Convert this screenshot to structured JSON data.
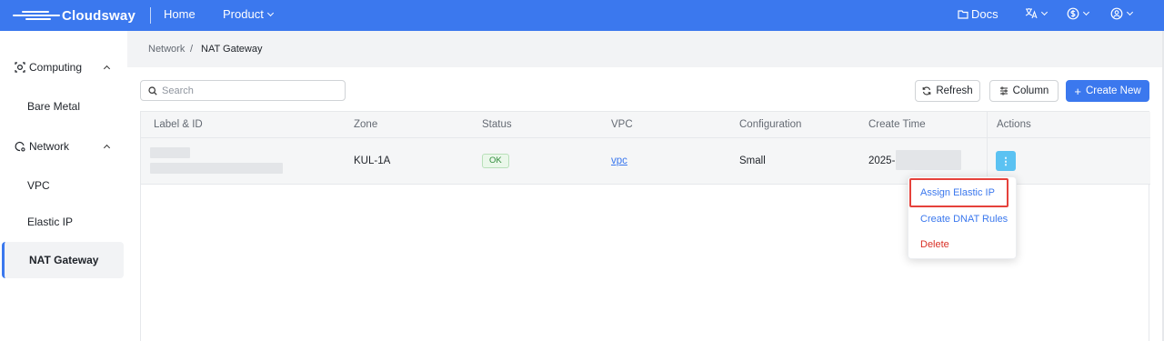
{
  "colors": {
    "brand": "#3b78ee",
    "danger": "#d93026",
    "status_ok": "#2e8b3a",
    "action_button": "#5bc2f2"
  },
  "header": {
    "logo_text": "Cloudsway",
    "nav": [
      {
        "label": "Home"
      },
      {
        "label": "Product"
      }
    ],
    "docs_label": "Docs",
    "icons": [
      "folder-icon",
      "translate-icon",
      "currency-icon",
      "user-circle-icon"
    ]
  },
  "sidebar": {
    "groups": [
      {
        "label": "Computing",
        "icon": "computing-icon",
        "expanded": true,
        "items": [
          {
            "label": "Bare Metal"
          }
        ]
      },
      {
        "label": "Network",
        "icon": "network-icon",
        "expanded": true,
        "items": [
          {
            "label": "VPC"
          },
          {
            "label": "Elastic IP"
          },
          {
            "label": "NAT Gateway",
            "active": true
          }
        ]
      }
    ]
  },
  "breadcrumb": {
    "items": [
      "Network",
      "NAT Gateway"
    ],
    "separator": "/"
  },
  "toolbar": {
    "search_placeholder": "Search",
    "refresh_label": "Refresh",
    "column_label": "Column",
    "create_label": "Create New"
  },
  "table": {
    "columns": [
      "Label & ID",
      "Zone",
      "Status",
      "VPC",
      "Configuration",
      "Create Time",
      "Actions"
    ],
    "rows": [
      {
        "zone": "KUL-1A",
        "status": "OK",
        "vpc": "vpc",
        "configuration": "Small",
        "create_time": "2025-"
      }
    ]
  },
  "actions_menu": {
    "kebab_label": "⋮",
    "items": [
      {
        "label": "Assign Elastic IP",
        "tone": "blue",
        "highlighted": true
      },
      {
        "label": "Create DNAT Rules",
        "tone": "blue"
      },
      {
        "label": "Delete",
        "tone": "red"
      }
    ]
  }
}
